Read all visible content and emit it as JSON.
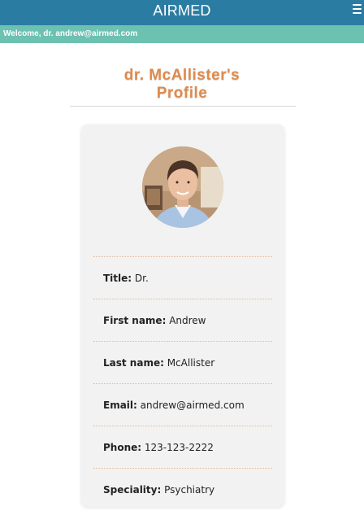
{
  "header": {
    "brand": "AIRMED",
    "menu_icon": "hamburger-icon"
  },
  "welcome": {
    "text": "Welcome, dr. andrew@airmed.com"
  },
  "profile": {
    "title_line1": "dr. McAllister's",
    "title_line2": "Profile",
    "fields": [
      {
        "label": "Title:",
        "value": " Dr."
      },
      {
        "label": "First name:",
        "value": " Andrew"
      },
      {
        "label": "Last name:",
        "value": " McAllister"
      },
      {
        "label": "Email:",
        "value": " andrew@airmed.com"
      },
      {
        "label": "Phone:",
        "value": " 123-123-2222"
      },
      {
        "label": "Speciality:",
        "value": " Psychiatry"
      }
    ]
  },
  "colors": {
    "topbar": "#2b7ca3",
    "welcome_bar": "#6cc1b0",
    "title": "#e08a4c"
  }
}
